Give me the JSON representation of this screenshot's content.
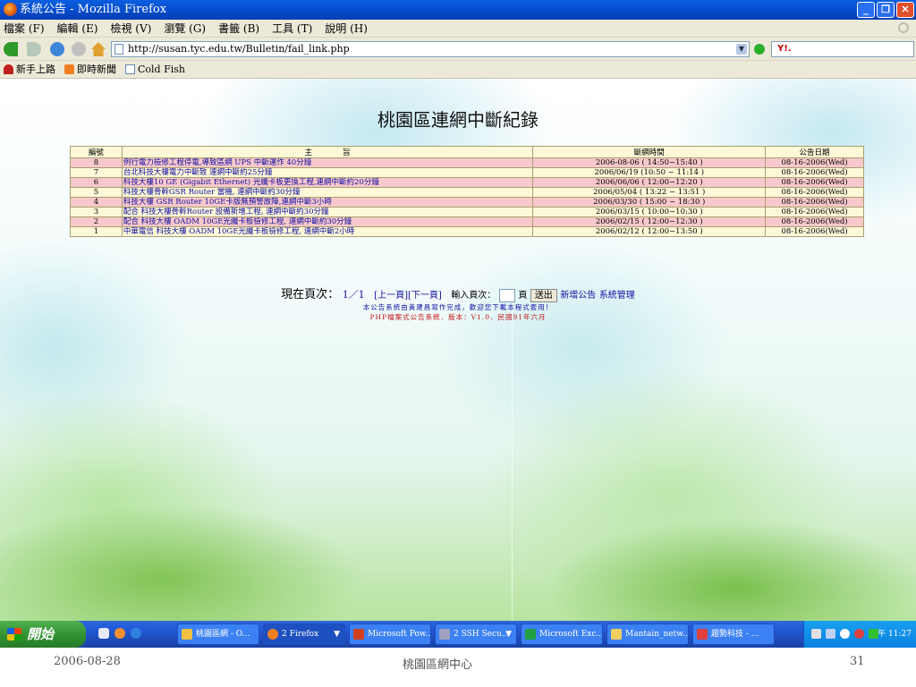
{
  "window": {
    "title": "系統公告 - Mozilla Firefox",
    "controls": [
      "_",
      "❐",
      "✕"
    ]
  },
  "menu": [
    "檔案 (F)",
    "編輯 (E)",
    "檢視 (V)",
    "瀏覽 (G)",
    "書籤 (B)",
    "工具 (T)",
    "說明 (H)"
  ],
  "nav": {
    "url": "http://susan.tyc.edu.tw/Bulletin/fail_link.php",
    "search_badge": "Y!."
  },
  "bookmarks": [
    "新手上路",
    "即時新聞",
    "Cold Fish"
  ],
  "page": {
    "title": "桃園區連網中斷紀錄",
    "headers": [
      "編號",
      "主　　　　旨",
      "斷網時間",
      "公告日期"
    ],
    "rows": [
      {
        "no": "8",
        "subject": "例行電力檢修工程停電,導致區網 UPS 中斷運作 40分鐘",
        "time": "2006-08-06 ( 14:50~15:40 )",
        "date": "08-16-2006(Wed)"
      },
      {
        "no": "7",
        "subject": "台北科技大樓電力中斷致 連網中斷約25分鐘",
        "time": "2006/06/19 (10:50 ~ 11:14 )",
        "date": "08-16-2006(Wed)"
      },
      {
        "no": "6",
        "subject": "科技大樓10 GE (Gigabit Ethernet) 光纖卡板更換工程,連網中斷約20分鐘",
        "time": "2006/06/06 ( 12:00~12:20 )",
        "date": "08-16-2006(Wed)"
      },
      {
        "no": "5",
        "subject": "科技大樓骨幹GSR Router 當機, 連網中斷約30分鐘",
        "time": "2006/05/04 ( 13:22 ~ 13:51 )",
        "date": "08-16-2006(Wed)"
      },
      {
        "no": "4",
        "subject": "科技大樓 GSR Router 10GE卡版無預警故障,連網中斷3小時",
        "time": "2006/03/30 ( 15:00 ~ 18:30 )",
        "date": "08-16-2006(Wed)"
      },
      {
        "no": "3",
        "subject": "配合 科技大樓骨幹Router 設備新增工程, 連網中斷約30分鐘",
        "time": "2006/03/15 ( 10:00~10:30 )",
        "date": "08-16-2006(Wed)"
      },
      {
        "no": "2",
        "subject": "配合 科技大樓 OADM 10GE光纖卡板檢修工程, 連網中斷約30分鐘",
        "time": "2006/02/15 ( 12:00~12:30 )",
        "date": "08-16-2006(Wed)"
      },
      {
        "no": "1",
        "subject": "中華電信 科技大樓 OADM 10GE光纖卡板檢修工程, 連網中斷2小時",
        "time": "2006/02/12 ( 12:00~13:50 )",
        "date": "08-16-2006(Wed)"
      }
    ],
    "pager": {
      "label": "現在頁次：",
      "current": "1／1",
      "prev": "[上一頁]",
      "next": "[下一頁]",
      "input_label": "輸入頁次：",
      "page_unit": "頁",
      "submit": "送出",
      "add_link": "新增公告",
      "admin_link": "系統管理"
    },
    "footer_line1": "本公告系統由黃建昌寫作完成，歡迎您下載本程式套用！",
    "footer_line2": "PHP檔案式公告系統．版本：V1.0．民國91年六月"
  },
  "taskbar": {
    "start": "開始",
    "tasks": [
      "桃園區網 - O...",
      "2 Firefox",
      "Microsoft Pow...",
      "2 SSH Secu...",
      "Microsoft Exc...",
      "Mantain_netw...",
      "趨勢科技 - ..."
    ],
    "clock": "上午 11:27"
  },
  "slide_remnant": {
    "left": "2006-08-28",
    "center": "桃園區網中心",
    "right": "31"
  }
}
